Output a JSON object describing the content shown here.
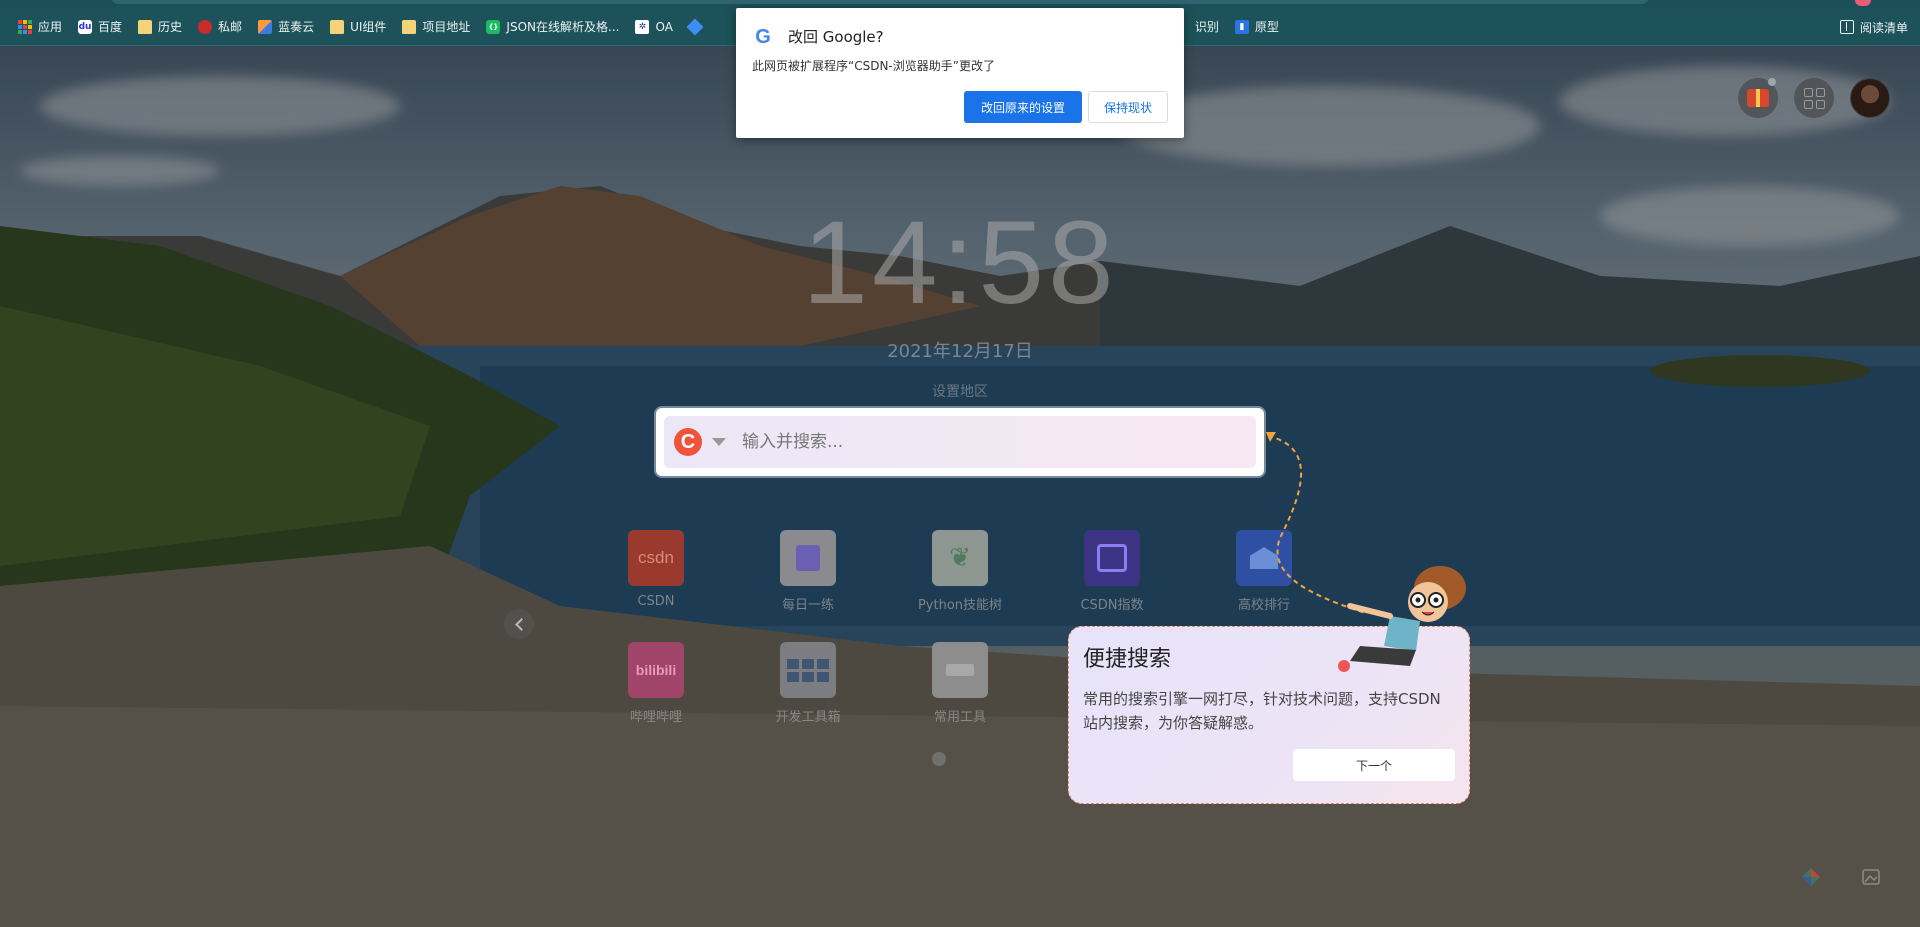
{
  "bookmarks": [
    {
      "label": "应用",
      "icon": "apps-grid-icon"
    },
    {
      "label": "百度",
      "icon": "baidu-icon"
    },
    {
      "label": "历史",
      "icon": "folder-icon"
    },
    {
      "label": "私邮",
      "icon": "mail-icon"
    },
    {
      "label": "蓝奏云",
      "icon": "lanzou-icon"
    },
    {
      "label": "UI组件",
      "icon": "folder-icon"
    },
    {
      "label": "项目地址",
      "icon": "folder-icon"
    },
    {
      "label": "JSON在线解析及格...",
      "icon": "json-icon"
    },
    {
      "label": "OA",
      "icon": "oa-icon"
    },
    {
      "label": "识别",
      "icon": "diamond-icon"
    },
    {
      "label": "原型",
      "icon": "prototype-icon"
    }
  ],
  "reading_list": "阅读清单",
  "google_dialog": {
    "title": "改回 Google?",
    "message": "此网页被扩展程序“CSDN-浏览器助手”更改了",
    "revert_label": "改回原来的设置",
    "keep_label": "保持现状",
    "logo_letter": "G"
  },
  "clock": {
    "time": "14:58",
    "date": "2021年12月17日",
    "region": "设置地区"
  },
  "search": {
    "placeholder": "输入并搜索...",
    "engine_letter": "C"
  },
  "apps": [
    {
      "label": "CSDN",
      "glyph": "csdn"
    },
    {
      "label": "每日一练",
      "glyph": ""
    },
    {
      "label": "Python技能树",
      "glyph": "❦"
    },
    {
      "label": "CSDN指数",
      "glyph": ""
    },
    {
      "label": "高校排行",
      "glyph": ""
    },
    {
      "label": "哔哩哔哩",
      "glyph": "bilibili"
    },
    {
      "label": "开发工具箱",
      "glyph": ""
    },
    {
      "label": "常用工具",
      "glyph": ""
    }
  ],
  "guide": {
    "title": "便捷搜索",
    "body": "常用的搜索引擎一网打尽，针对技术问题，支持CSDN站内搜索，为你答疑解惑。",
    "next_label": "下一个"
  },
  "colors": {
    "accent": "#1a73e8",
    "csdn_red": "#f0533a",
    "bookmarks_bar": "#1d525a"
  }
}
